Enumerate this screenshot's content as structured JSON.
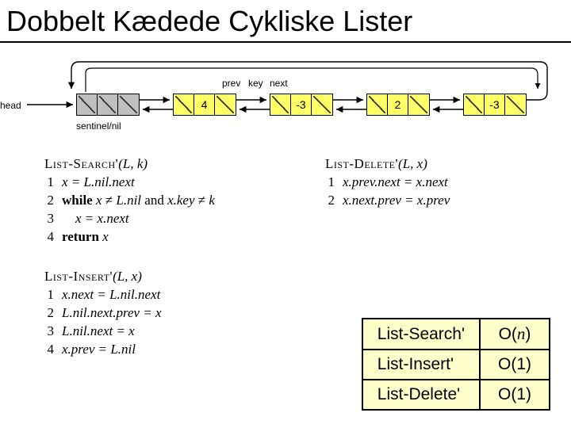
{
  "title": "Dobbelt Kædede Cykliske Lister",
  "diagram": {
    "labels": {
      "head": "head",
      "sentinel": "sentinel/nil",
      "prev": "prev",
      "key": "key",
      "next": "next"
    },
    "nodes": [
      {
        "key": "",
        "sentinel": true
      },
      {
        "key": "4"
      },
      {
        "key": "-3"
      },
      {
        "key": "2"
      },
      {
        "key": "-3"
      }
    ]
  },
  "algorithms": {
    "search": {
      "name": "List-Search'",
      "args": "(L, k)",
      "lines": [
        {
          "n": "1",
          "code": "x = L.nil.next"
        },
        {
          "n": "2",
          "code_html": "<span class='kw'>while</span> <span class='it'>x</span> ≠ <span class='it'>L.nil</span> and <span class='it'>x.key</span> ≠ <span class='it'>k</span>"
        },
        {
          "n": "3",
          "code": "    x = x.next"
        },
        {
          "n": "4",
          "code_html": "<span class='kw'>return</span> <span class='it'>x</span>"
        }
      ]
    },
    "delete": {
      "name": "List-Delete'",
      "args": "(L, x)",
      "lines": [
        {
          "n": "1",
          "code": "x.prev.next = x.next"
        },
        {
          "n": "2",
          "code": "x.next.prev = x.prev"
        }
      ]
    },
    "insert": {
      "name": "List-Insert'",
      "args": "(L, x)",
      "lines": [
        {
          "n": "1",
          "code": "x.next = L.nil.next"
        },
        {
          "n": "2",
          "code": "L.nil.next.prev = x"
        },
        {
          "n": "3",
          "code": "L.nil.next = x"
        },
        {
          "n": "4",
          "code": "x.prev = L.nil"
        }
      ]
    }
  },
  "complexity": {
    "rows": [
      {
        "op": "List-Search'",
        "big_o_html": "O(<span class='timesit'>n</span>)"
      },
      {
        "op": "List-Insert'",
        "big_o_html": "O(1)"
      },
      {
        "op": "List-Delete'",
        "big_o_html": "O(1)"
      }
    ]
  }
}
